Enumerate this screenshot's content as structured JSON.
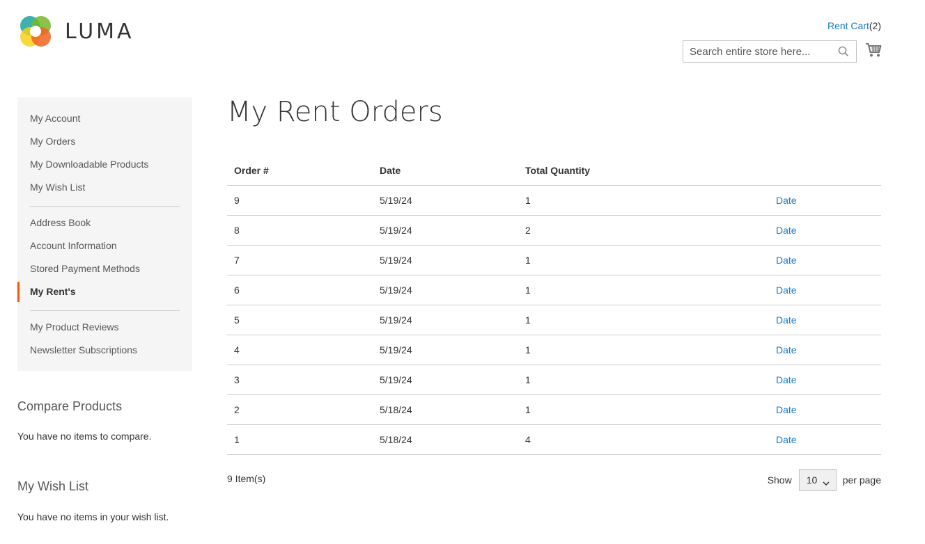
{
  "header": {
    "logo_text": "LUMA",
    "rent_cart_label": "Rent Cart",
    "rent_cart_count": "(2)",
    "search_placeholder": "Search entire store here..."
  },
  "sidebar": {
    "groups": [
      [
        "My Account",
        "My Orders",
        "My Downloadable Products",
        "My Wish List"
      ],
      [
        "Address Book",
        "Account Information",
        "Stored Payment Methods",
        "My Rent's"
      ],
      [
        "My Product Reviews",
        "Newsletter Subscriptions"
      ]
    ],
    "active_item": "My Rent's",
    "accent_color": "#ff5501"
  },
  "compare": {
    "title": "Compare Products",
    "empty_text": "You have no items to compare."
  },
  "wishlist": {
    "title": "My Wish List",
    "empty_text": "You have no items in your wish list."
  },
  "main": {
    "page_title": "My Rent Orders",
    "table": {
      "headers": [
        "Order #",
        "Date",
        "Total Quantity",
        ""
      ],
      "rows": [
        {
          "order": "9",
          "date": "5/19/24",
          "qty": "1",
          "action": "Date"
        },
        {
          "order": "8",
          "date": "5/19/24",
          "qty": "2",
          "action": "Date"
        },
        {
          "order": "7",
          "date": "5/19/24",
          "qty": "1",
          "action": "Date"
        },
        {
          "order": "6",
          "date": "5/19/24",
          "qty": "1",
          "action": "Date"
        },
        {
          "order": "5",
          "date": "5/19/24",
          "qty": "1",
          "action": "Date"
        },
        {
          "order": "4",
          "date": "5/19/24",
          "qty": "1",
          "action": "Date"
        },
        {
          "order": "3",
          "date": "5/19/24",
          "qty": "1",
          "action": "Date"
        },
        {
          "order": "2",
          "date": "5/18/24",
          "qty": "1",
          "action": "Date"
        },
        {
          "order": "1",
          "date": "5/18/24",
          "qty": "4",
          "action": "Date"
        }
      ]
    },
    "items_count": "9 Item(s)",
    "limiter": {
      "show_label": "Show",
      "selected": "10",
      "per_page_label": "per page"
    }
  },
  "colors": {
    "link": "#1979c3",
    "sidebar_bg": "#f5f5f5"
  }
}
